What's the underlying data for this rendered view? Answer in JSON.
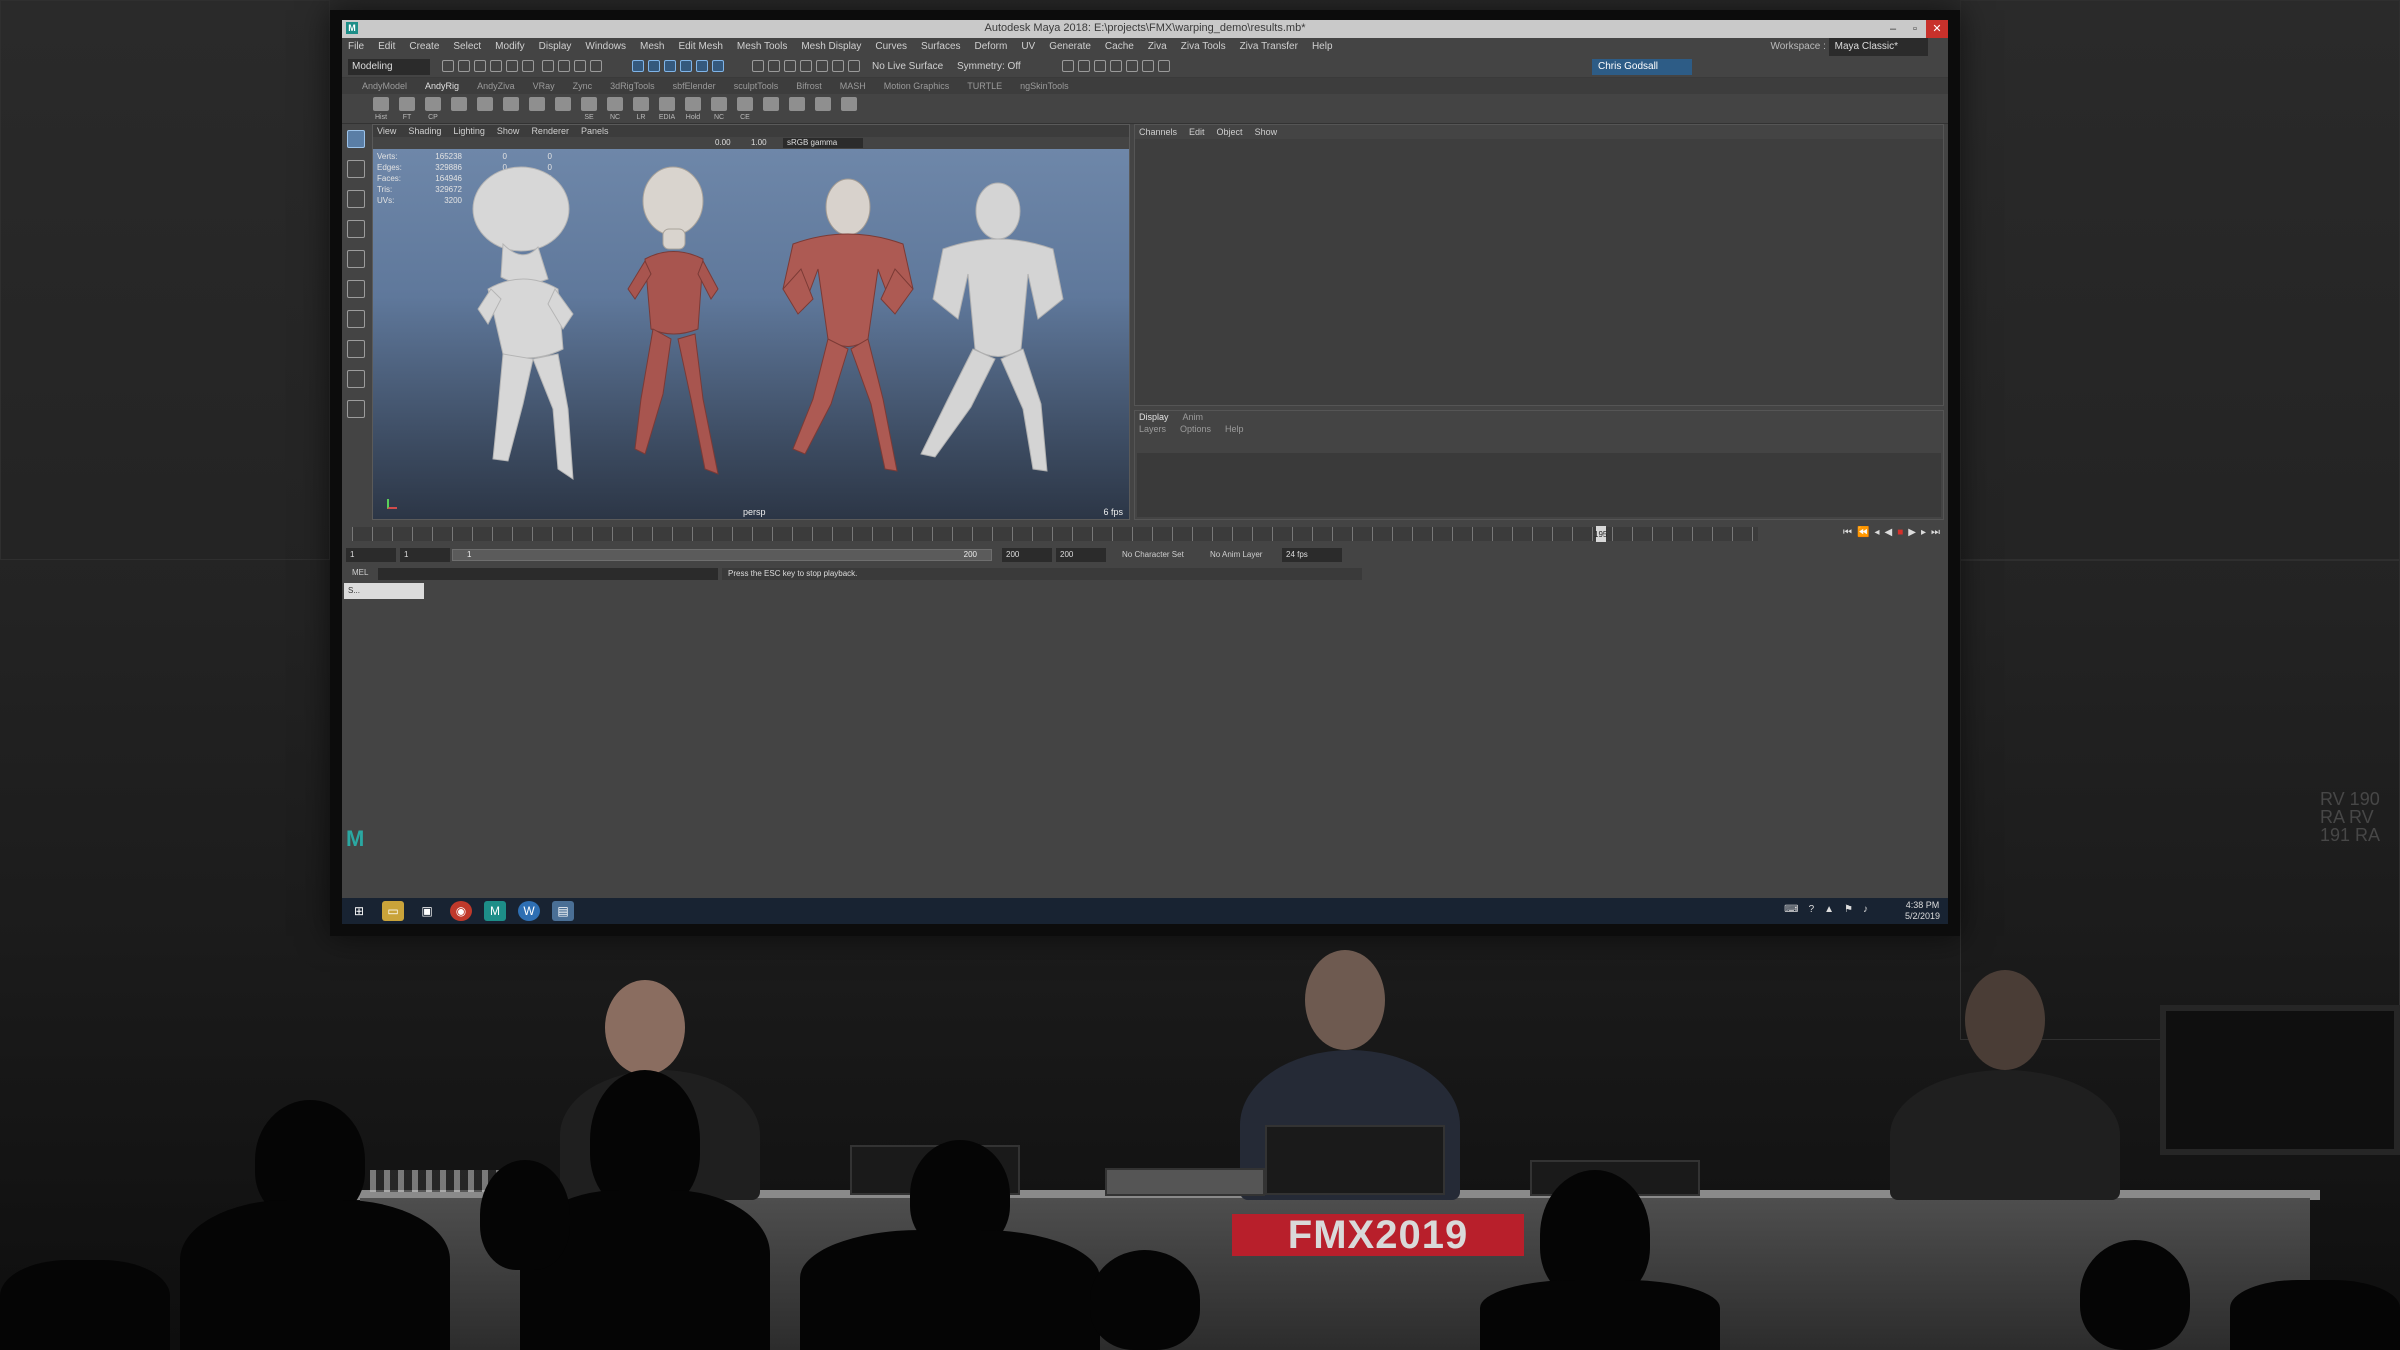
{
  "maya": {
    "window_title": "Autodesk Maya 2018: E:\\projects\\FMX\\warping_demo\\results.mb*",
    "app_icon": "M",
    "window_buttons": [
      "–",
      "▫",
      "✕"
    ],
    "menus": [
      "File",
      "Edit",
      "Create",
      "Select",
      "Modify",
      "Display",
      "Windows",
      "Mesh",
      "Edit Mesh",
      "Mesh Tools",
      "Mesh Display",
      "Curves",
      "Surfaces",
      "Deform",
      "UV",
      "Generate",
      "Cache",
      "Ziva",
      "Ziva Tools",
      "Ziva Transfer",
      "Help"
    ],
    "workspace_label": "Workspace :",
    "workspace_value": "Maya Classic*",
    "mode": "Modeling",
    "no_live_surface": "No Live Surface",
    "symmetry": "Symmetry: Off",
    "user": "Chris Godsall",
    "shelf_tabs": [
      "AndyModel",
      "AndyRig",
      "AndyZiva",
      "VRay",
      "Zync",
      "3dRigTools",
      "sbfElender",
      "sculptTools",
      "Bifrost",
      "MASH",
      "Motion Graphics",
      "TURTLE",
      "ngSkinTools"
    ],
    "active_shelf_tab": "AndyRig",
    "shelf_icon_labels": [
      "Hist",
      "FT",
      "CP",
      "",
      "",
      "",
      "",
      "",
      "SE",
      "NC",
      "LR",
      "EDIA",
      "Hold",
      "NC",
      "CE",
      "",
      "",
      "",
      ""
    ],
    "viewport": {
      "menu": [
        "View",
        "Shading",
        "Lighting",
        "Show",
        "Renderer",
        "Panels"
      ],
      "field_a": "0.00",
      "field_b": "1.00",
      "color_space": "sRGB gamma",
      "hud": [
        {
          "label": "Verts:",
          "value": "165238",
          "extra": "0",
          "extra2": "0"
        },
        {
          "label": "Edges:",
          "value": "329886",
          "extra": "0",
          "extra2": "0"
        },
        {
          "label": "Faces:",
          "value": "164946",
          "extra": "0",
          "extra2": "0"
        },
        {
          "label": "Tris:",
          "value": "329672",
          "extra": "0",
          "extra2": "0"
        },
        {
          "label": "UVs:",
          "value": "3200",
          "extra": "0",
          "extra2": "0"
        }
      ],
      "camera": "persp",
      "fps": "6 fps"
    },
    "channel_box_menu": [
      "Channels",
      "Edit",
      "Object",
      "Show"
    ],
    "layer_tabs": [
      "Display",
      "Anim"
    ],
    "layer_menu": [
      "Layers",
      "Options",
      "Help"
    ],
    "timeline": {
      "current_frame": "195",
      "start": "1",
      "start2": "1",
      "range_start": "1",
      "range_end": "200",
      "end": "200",
      "end2": "200",
      "character_set": "No Character Set",
      "anim_layer": "No Anim Layer",
      "fps": "24 fps"
    },
    "command_label": "MEL",
    "help_line": "Press the ESC key to stop playback.",
    "mini_window": "S..."
  },
  "taskbar": {
    "clock_time": "4:38 PM",
    "clock_date": "5/2/2019"
  },
  "stage": {
    "banner": "FMX2019",
    "wall_text": "RV 190 RA RV 191 RA"
  },
  "colors": {
    "banner": "#b81f2b",
    "maya_teal": "#1d8e88",
    "muscle": "#a8554f",
    "mesh": "#d6d6d6"
  }
}
